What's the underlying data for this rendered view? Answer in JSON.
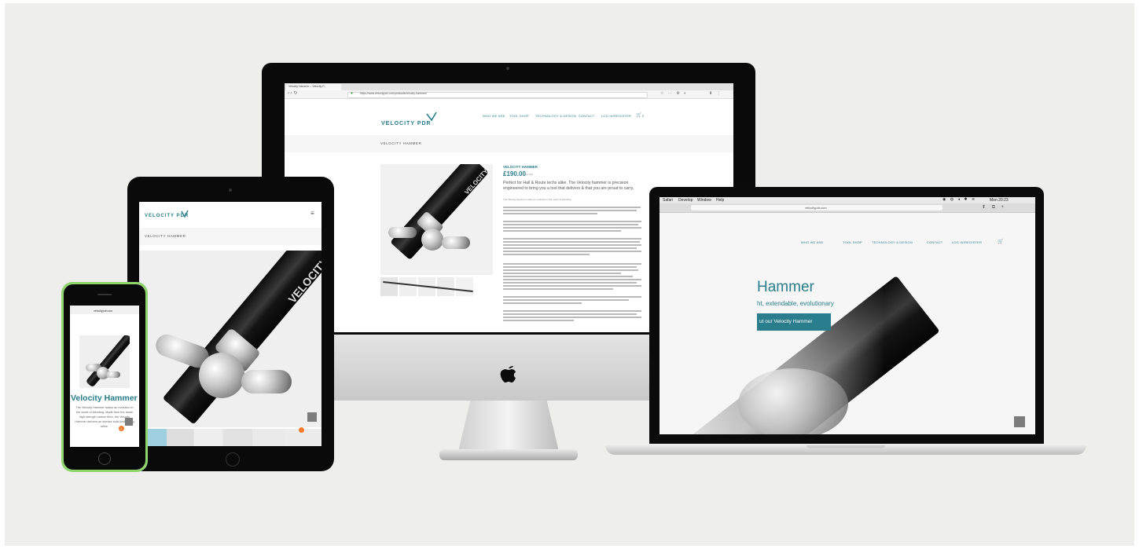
{
  "colors": {
    "accent": "#2a7d8c",
    "phone_frame": "#8fd46e",
    "device": "#0a0a0a",
    "background": "#eeeeec"
  },
  "imac": {
    "tab_title": "Velocity Hammer – Velocity P...",
    "url": "https://www.velocitypdr.com/products/velocity-hammer/",
    "logo": "VELOCITY PDR",
    "nav": [
      "WHO WE ARE",
      "TOOL SHOP",
      "TECHNOLOGY & DESIGN",
      "CONTACT",
      "LOG IN/REGISTER"
    ],
    "cart": "0",
    "page_title": "VELOCITY HAMMER",
    "product_name": "VELOCITY HAMMER",
    "price": "£190.00",
    "vat": "inc VAT",
    "lead": "Perfect for Hail & Route techs alike. The Velocity hammer is precision engineered to bring you a tool that delivers & that you are proud to carry.",
    "p1": "The Velocity Hammer marks an evolution in the world of blending.",
    "shaft_text": "VELOCITY"
  },
  "laptop": {
    "menu": [
      "Safari",
      "Develop",
      "Window",
      "Help"
    ],
    "clock": "Mon 20:23",
    "url": "velocitypdr.com",
    "nav": [
      "WHO WE ARE",
      "TOOL SHOP",
      "TECHNOLOGY & DESIGN",
      "CONTACT",
      "LOG IN/REGISTER"
    ],
    "hero_title": "Hammer",
    "hero_sub": "ht, extendable, evolutionary",
    "cta": "ut our Velocity Hammer"
  },
  "tablet": {
    "logo": "VELOCITY PDR",
    "page_title": "VELOCITY HAMMER",
    "shaft_text": "VELOCITY"
  },
  "phone": {
    "url": "velocitypdr.com",
    "title": "Velocity Hammer",
    "body": "The Velocity Hammer marks an evolution in the world of blending. Made from the same high strength carbon fibre, the Velocity Hammer delivers an intense solid and strong strike.",
    "badge": "1"
  }
}
